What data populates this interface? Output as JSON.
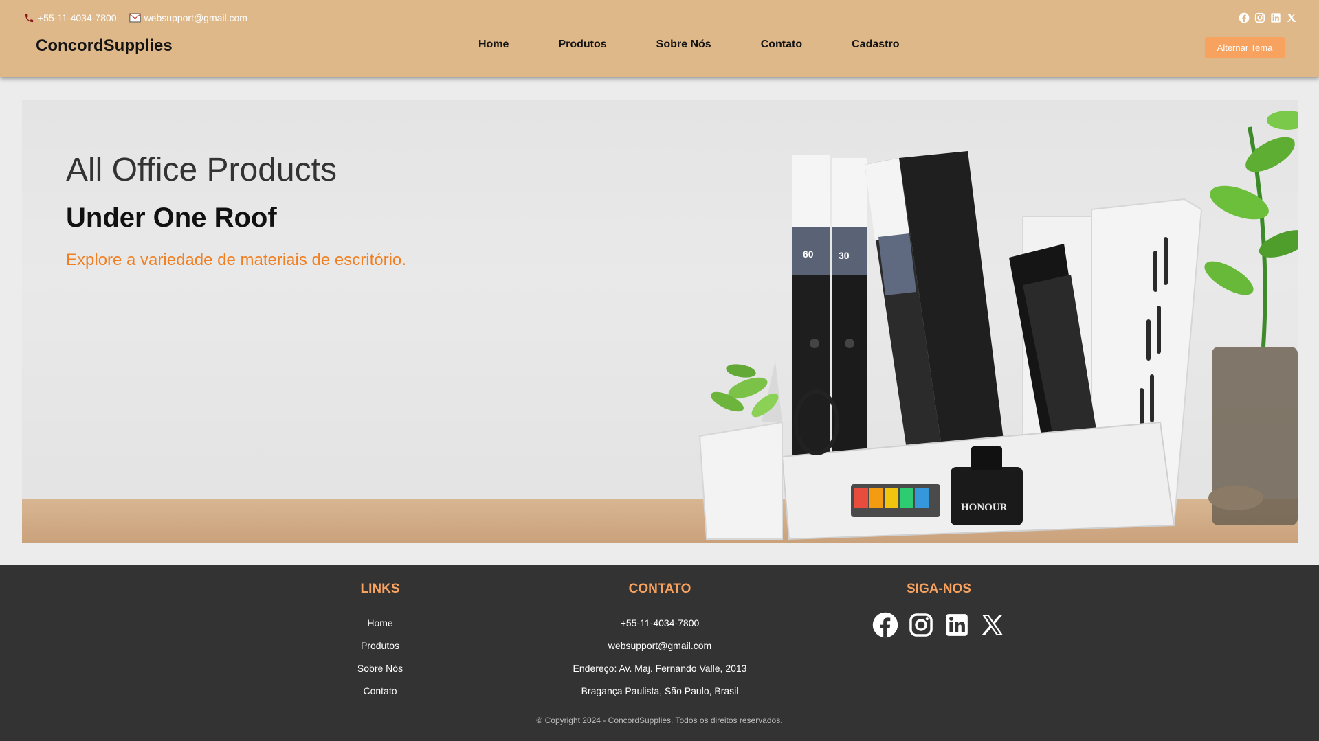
{
  "topbar": {
    "phone": "+55-11-4034-7800",
    "email": "websupport@gmail.com"
  },
  "brand": "ConcordSupplies",
  "nav": [
    "Home",
    "Produtos",
    "Sobre Nós",
    "Contato",
    "Cadastro"
  ],
  "theme_button": "Alternar Tema",
  "hero": {
    "title": "All Office Products",
    "subtitle": "Under One Roof",
    "description": "Explore a variedade de materiais de escritório.",
    "binder_labels": [
      "60",
      "30"
    ],
    "ink_label": "HONOUR"
  },
  "footer": {
    "links_title": "LINKS",
    "links": [
      "Home",
      "Produtos",
      "Sobre Nós",
      "Contato"
    ],
    "contact_title": "CONTATO",
    "contact": [
      "+55-11-4034-7800",
      "websupport@gmail.com",
      "Endereço: Av. Maj. Fernando Valle, 2013",
      "Bragança Paulista, São Paulo, Brasil"
    ],
    "follow_title": "SIGA-NOS",
    "copyright": "© Copyright 2024 - ConcordSupplies. Todos os direitos reservados."
  },
  "social_icons": [
    "facebook-icon",
    "instagram-icon",
    "linkedin-icon",
    "x-icon"
  ],
  "colors": {
    "header_bg": "#dfb889",
    "accent": "#f8a25f",
    "hero_text_accent": "#f07f22",
    "footer_bg": "#333333"
  }
}
